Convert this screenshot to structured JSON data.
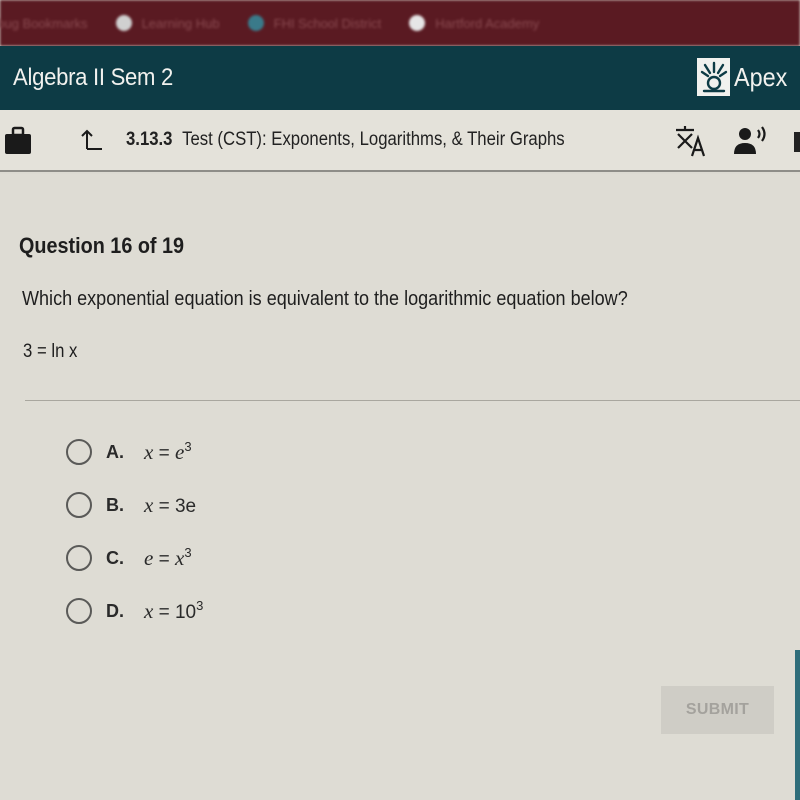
{
  "browser": {
    "bookmarks": [
      {
        "label": "ebug Bookmarks",
        "icon": "bookmark-icon",
        "color": "#5a1a22"
      },
      {
        "label": "Learning Hub",
        "icon": "penguin-icon",
        "color": "#c8c8c8"
      },
      {
        "label": "FHI School District",
        "icon": "school-icon",
        "color": "#3a8a5a"
      },
      {
        "label": "Hartford Academy",
        "icon": "globe-icon",
        "color": "#d8d8d8"
      }
    ]
  },
  "course": {
    "title": "Algebra II Sem 2",
    "brand": "Apex",
    "header_color": "#0d3b45"
  },
  "toolbar": {
    "activity_number": "3.13.3",
    "activity_title": "Test (CST): Exponents, Logarithms, & Their Graphs",
    "icons": [
      "briefcase-icon",
      "up-arrow-icon",
      "translate-icon",
      "text-to-speech-icon"
    ]
  },
  "question": {
    "counter": "Question 16 of 19",
    "prompt": "Which exponential equation is equivalent to the logarithmic equation below?",
    "equation": "3 = ln x",
    "choices": [
      {
        "letter": "A.",
        "lhs": "x",
        "rhs_base": "e",
        "rhs_exp": "3",
        "text": "x = e^3",
        "selected": false
      },
      {
        "letter": "B.",
        "lhs": "x",
        "rhs_base": "3e",
        "rhs_exp": "",
        "text": "x = 3e",
        "selected": false
      },
      {
        "letter": "C.",
        "lhs": "e",
        "rhs_base": "x",
        "rhs_exp": "3",
        "text": "e = x^3",
        "selected": false
      },
      {
        "letter": "D.",
        "lhs": "x",
        "rhs_base": "10",
        "rhs_exp": "3",
        "text": "x = 10^3",
        "selected": false
      }
    ]
  },
  "actions": {
    "submit_label": "SUBMIT",
    "submit_enabled": false
  }
}
